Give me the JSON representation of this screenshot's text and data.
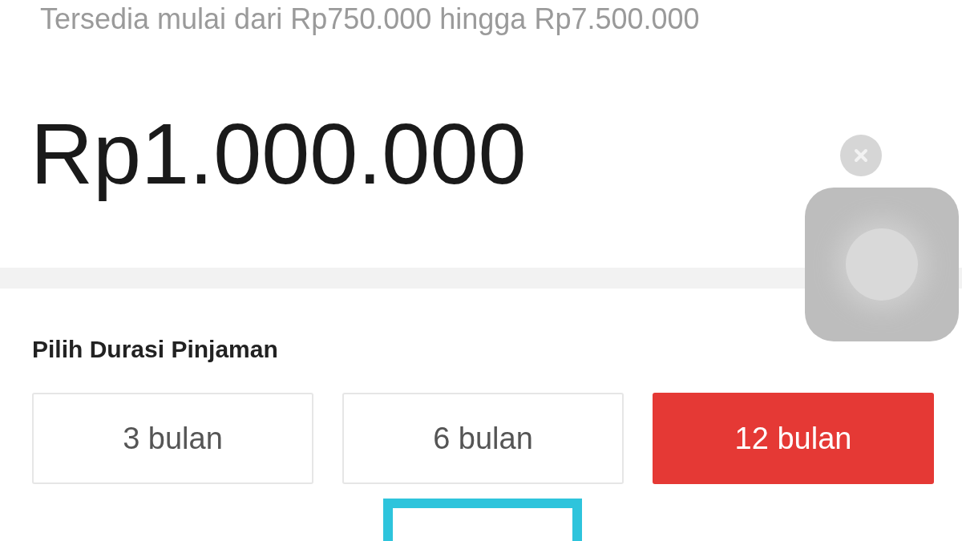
{
  "range_text": "Tersedia mulai dari Rp750.000 hingga Rp7.500.000",
  "amount": "Rp1.000.000",
  "duration": {
    "title": "Pilih Durasi Pinjaman",
    "options": [
      {
        "label": "3 bulan",
        "selected": false
      },
      {
        "label": "6 bulan",
        "selected": false
      },
      {
        "label": "12 bulan",
        "selected": true
      }
    ]
  }
}
